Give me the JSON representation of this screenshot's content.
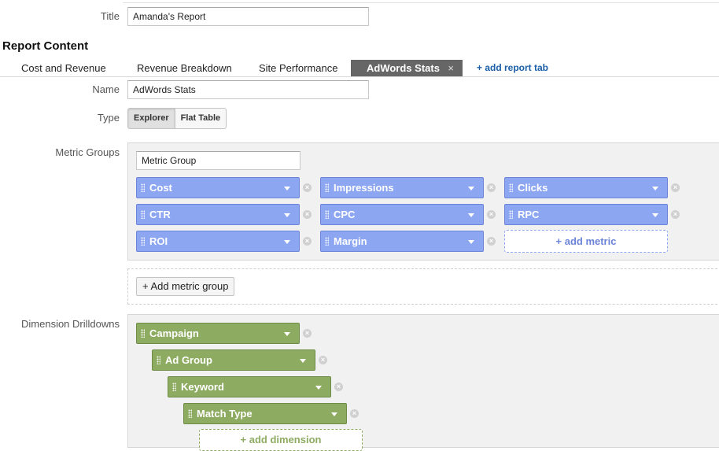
{
  "form": {
    "title_label": "Title",
    "title_value": "Amanda's Report",
    "section_title": "Report Content",
    "name_label": "Name",
    "name_value": "AdWords Stats",
    "type_label": "Type",
    "metric_groups_label": "Metric Groups",
    "dimension_drilldowns_label": "Dimension Drilldowns"
  },
  "tabs": {
    "items": [
      {
        "label": "Cost and Revenue"
      },
      {
        "label": "Revenue Breakdown"
      },
      {
        "label": "Site Performance"
      },
      {
        "label": "AdWords Stats",
        "active": true
      }
    ],
    "close_glyph": "×",
    "add_label": "+ add report tab"
  },
  "type_buttons": {
    "explorer": "Explorer",
    "flat_table": "Flat Table",
    "selected": "Explorer"
  },
  "metric_group": {
    "name_value": "Metric Group",
    "metrics": [
      "Cost",
      "Impressions",
      "Clicks",
      "CTR",
      "CPC",
      "RPC",
      "ROI",
      "Margin"
    ],
    "add_metric_label": "+ add metric",
    "add_group_label": "+ Add metric group"
  },
  "dimensions": {
    "items": [
      "Campaign",
      "Ad Group",
      "Keyword",
      "Match Type"
    ],
    "add_label": "+ add dimension"
  },
  "icons": {
    "remove": "remove-circle-icon",
    "dropdown": "caret-down-icon",
    "drag": "drag-handle-icon",
    "close": "close-icon"
  },
  "colors": {
    "metric_pill": "#8da6f2",
    "dimension_pill": "#8eab62",
    "active_tab": "#666666",
    "link": "#1a5fa8"
  }
}
